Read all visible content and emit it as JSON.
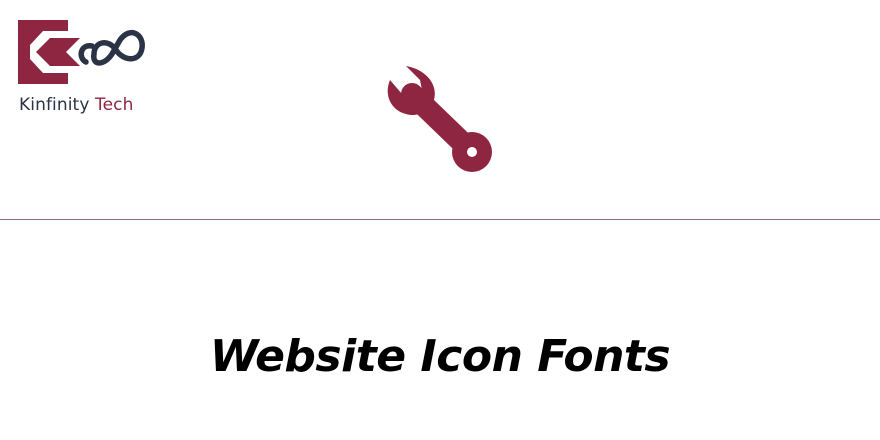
{
  "brand": {
    "name_part1": "Kinfinity",
    "name_part2": "Tech",
    "logo_icon": "k-infinity-logo-icon",
    "primary_color": "#8e2641",
    "secondary_color": "#2b3346"
  },
  "hero": {
    "icon": "wrench-icon",
    "color": "#8e2641"
  },
  "main": {
    "title": "Website Icon Fonts"
  }
}
